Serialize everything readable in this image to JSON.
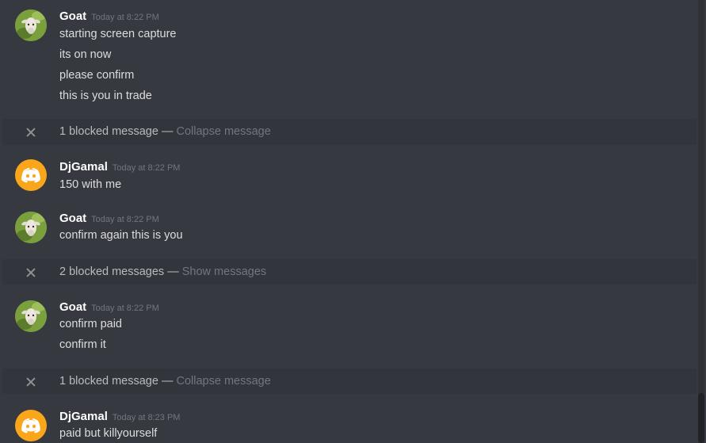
{
  "messages": [
    {
      "author": "Goat",
      "timestamp": "Today at 8:22 PM",
      "avatar_icon": "goat-avatar",
      "lines": [
        "starting screen capture",
        "its on now",
        "please confirm",
        "this is you in trade"
      ]
    },
    {
      "blocked_count_text": "1 blocked message",
      "separator": "—",
      "action": "Collapse message"
    },
    {
      "author": "DjGamal",
      "timestamp": "Today at 8:22 PM",
      "avatar_icon": "discord-logo-icon",
      "lines": [
        "150 with me"
      ]
    },
    {
      "author": "Goat",
      "timestamp": "Today at 8:22 PM",
      "avatar_icon": "goat-avatar",
      "lines": [
        "confirm again this is you"
      ]
    },
    {
      "blocked_count_text": "2 blocked messages",
      "separator": "—",
      "action": "Show messages"
    },
    {
      "author": "Goat",
      "timestamp": "Today at 8:22 PM",
      "avatar_icon": "goat-avatar",
      "lines": [
        "confirm paid",
        "confirm it"
      ]
    },
    {
      "blocked_count_text": "1 blocked message",
      "separator": "—",
      "action": "Collapse message"
    },
    {
      "author": "DjGamal",
      "timestamp": "Today at 8:23 PM",
      "avatar_icon": "discord-logo-icon",
      "lines": [
        "paid but killyourself"
      ]
    }
  ],
  "colors": {
    "background": "#36393f",
    "blocked_background": "#32353b",
    "discord_avatar": "#faa61a",
    "username": "#ffffff",
    "message_text": "#dcddde",
    "muted": "#72767d"
  }
}
